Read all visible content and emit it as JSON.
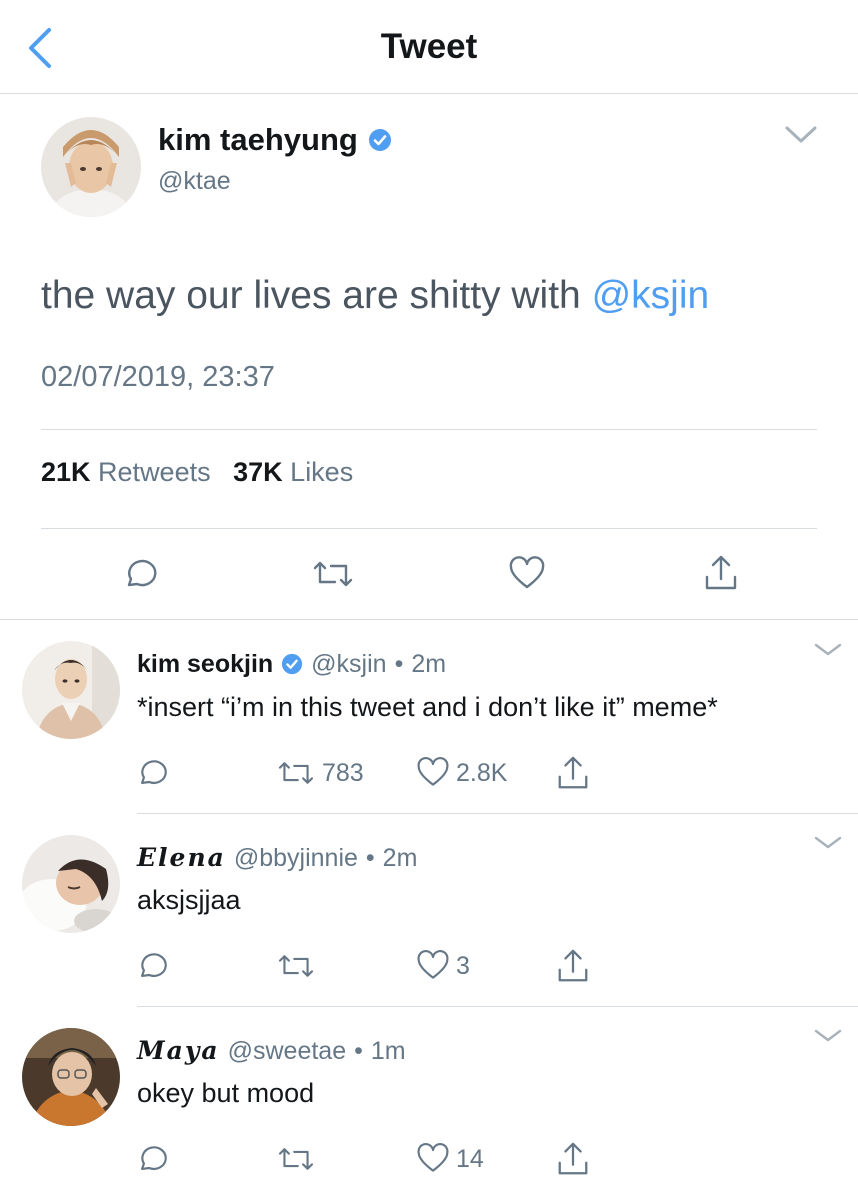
{
  "header": {
    "title": "Tweet",
    "back_icon": "chevron-left-icon"
  },
  "main_tweet": {
    "author_name": "kim taehyung",
    "author_handle": "@ktae",
    "verified": true,
    "text": "the way our lives are shitty with ",
    "mention": "@ksjin",
    "timestamp": "02/07/2019, 23:37",
    "retweets_count": "21K",
    "retweets_label": "Retweets",
    "likes_count": "37K",
    "likes_label": "Likes"
  },
  "replies": [
    {
      "name": "kim seokjin",
      "verified": true,
      "handle": "@ksjin",
      "separator": "•",
      "time": "2m",
      "text": "*insert “i’m in this tweet and i don’t like it” meme*",
      "retweets": "783",
      "likes": "2.8K"
    },
    {
      "name": "Elena",
      "verified": false,
      "handle": "@bbyjinnie",
      "separator": "•",
      "time": "2m",
      "text": "aksjsjjaa",
      "retweets": "",
      "likes": "3"
    },
    {
      "name": "Maya",
      "verified": false,
      "handle": "@sweetae",
      "separator": "•",
      "time": "1m",
      "text": "okey but mood",
      "retweets": "",
      "likes": "14"
    }
  ],
  "colors": {
    "accent": "#4f9ef2",
    "secondary_text": "#657786",
    "divider": "#d8dde1"
  }
}
